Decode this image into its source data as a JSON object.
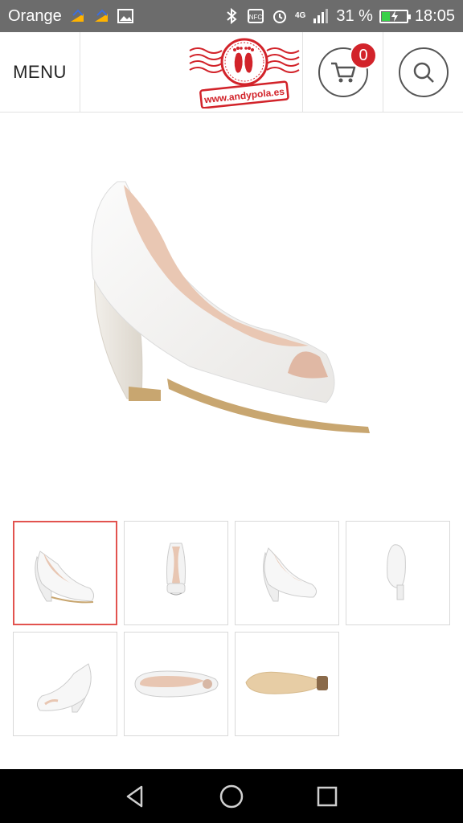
{
  "status_bar": {
    "carrier": "Orange",
    "network": "4G",
    "battery": "31 %",
    "battery_level": 0.31,
    "time": "18:05",
    "icons": [
      "carrier-signal-icon",
      "carrier-signal-icon",
      "image-icon",
      "bluetooth-icon",
      "nfc-icon",
      "alarm-icon",
      "signal-icon",
      "battery-icon"
    ]
  },
  "header": {
    "menu_label": "MENU",
    "logo_url_text": "www.andypola.es",
    "cart_count": "0",
    "icons": {
      "cart": "cart-icon",
      "search": "search-icon"
    }
  },
  "product": {
    "main_image": "white-peep-toe-platform-heel",
    "thumbnails": [
      {
        "view": "side-right",
        "active": true
      },
      {
        "view": "front"
      },
      {
        "view": "three-quarter"
      },
      {
        "view": "back"
      },
      {
        "view": "side-left"
      },
      {
        "view": "top"
      },
      {
        "view": "sole"
      }
    ]
  },
  "colors": {
    "brand_red": "#d2232a",
    "active_border": "#e2534f",
    "status_bar": "#6c6c6c",
    "nav_bar": "#000000"
  },
  "nav_bar": {
    "icons": [
      "back-icon",
      "home-icon",
      "recents-icon"
    ]
  }
}
